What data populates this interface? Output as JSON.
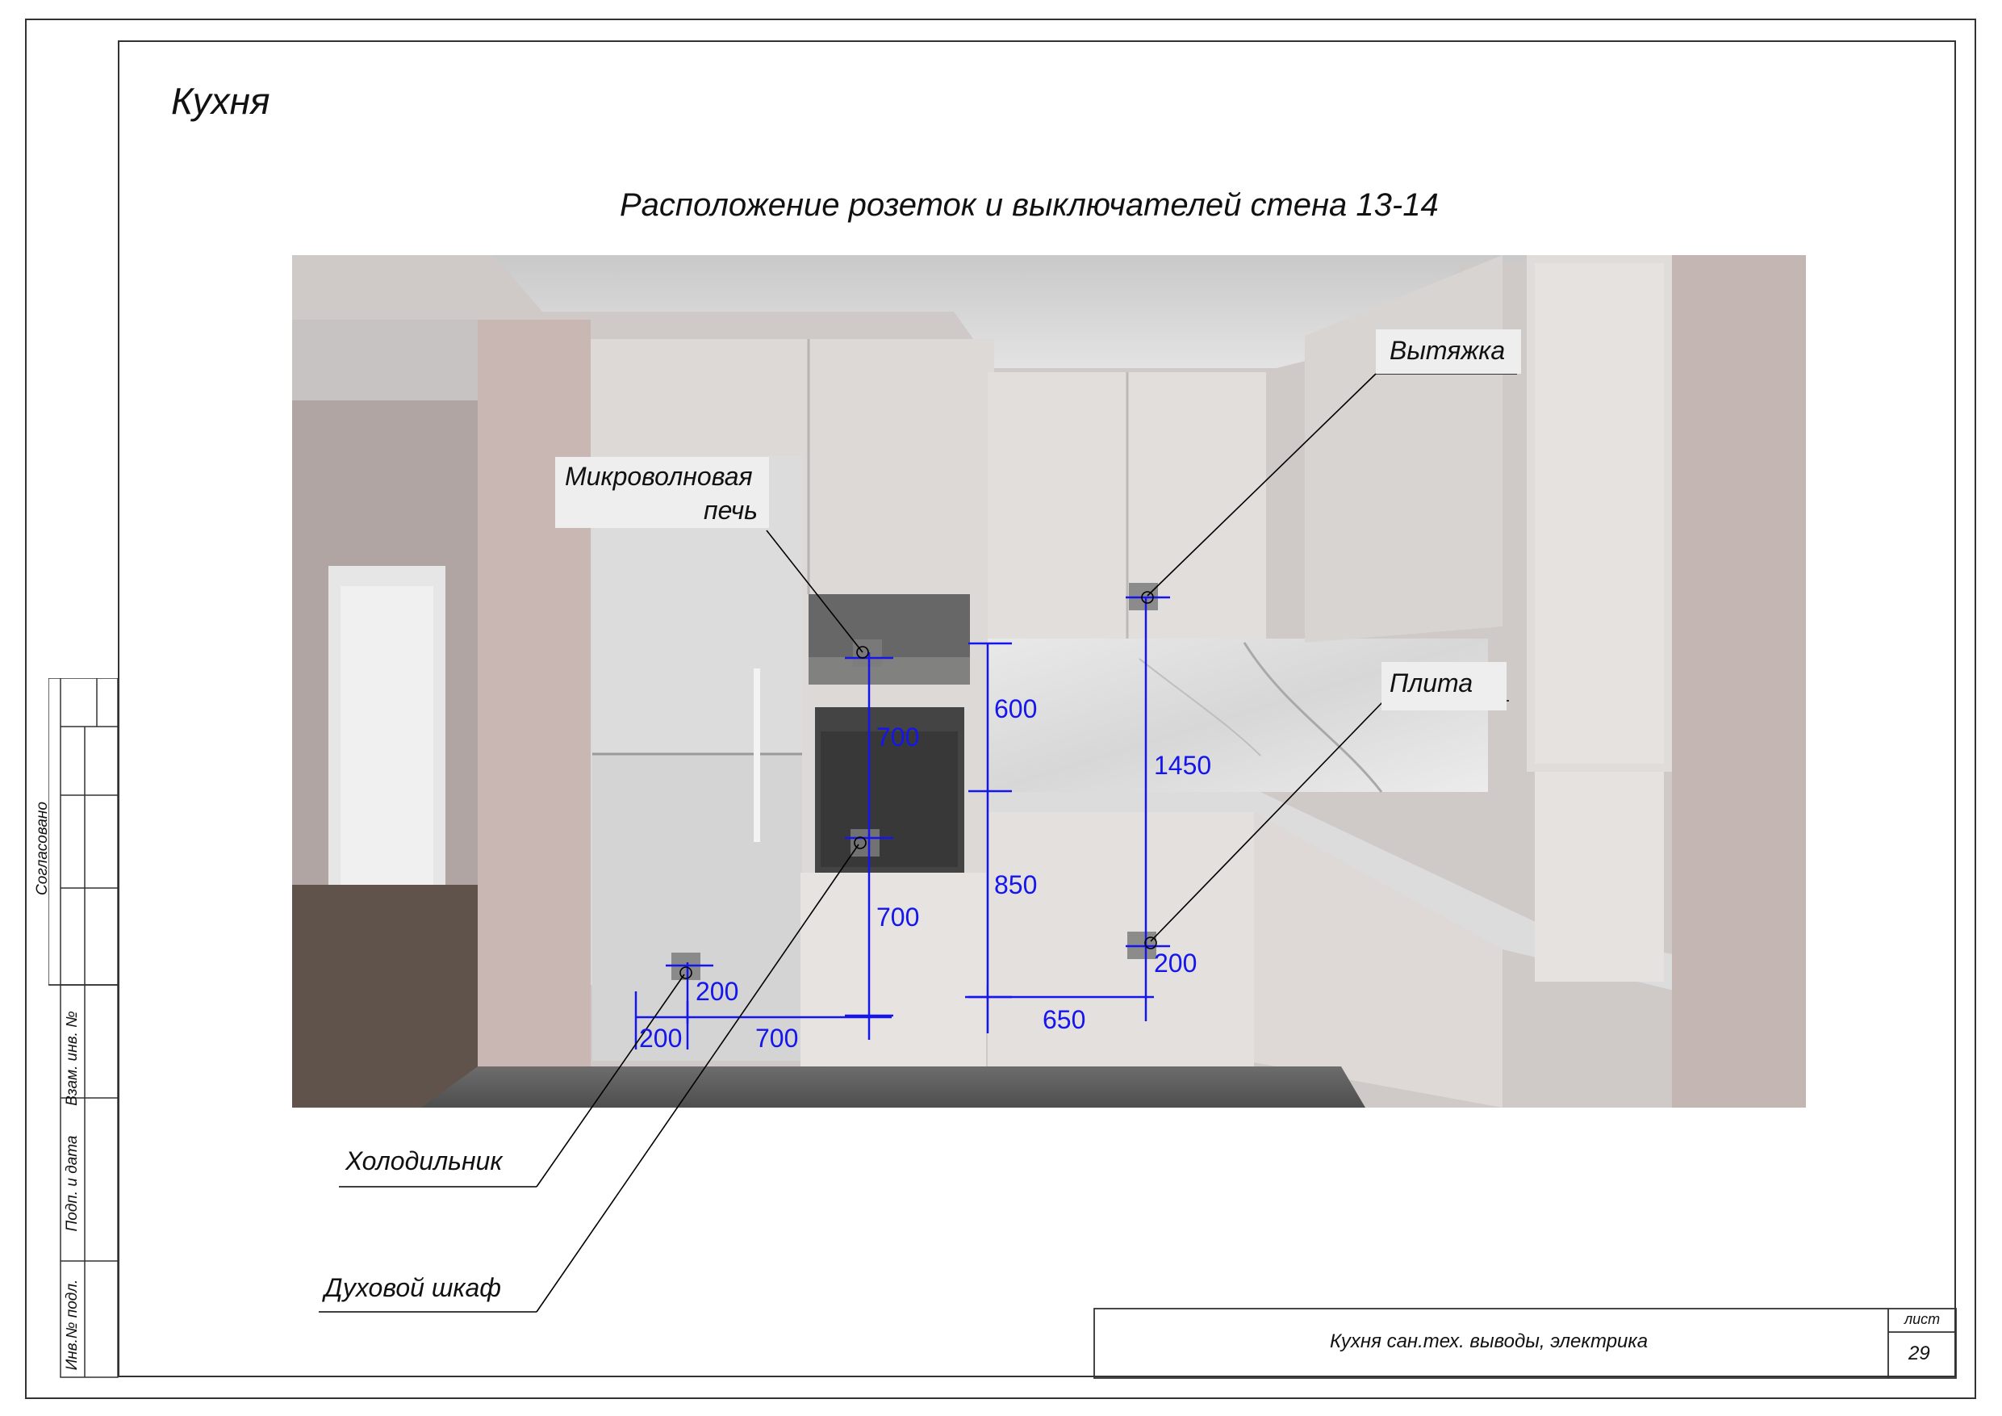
{
  "room_title": "Кухня",
  "sheet_title": "Расположение розеток и выключателей стена 13-14",
  "side_stamp": {
    "approved": "Согласовано",
    "ref_inv": "Взам. инв. №",
    "sign_date": "Подп. и дата",
    "inv_orig": "Инв.№ подл."
  },
  "title_block": {
    "description": "Кухня сан.тех. выводы, электрика",
    "sheet_label": "лист",
    "sheet_number": "29"
  },
  "callouts": {
    "hood": "Вытяжка",
    "microwave_line1": "Микроволновая",
    "microwave_line2": "печь",
    "stove": "Плита",
    "fridge": "Холодильник",
    "oven": "Духовой шкаф"
  },
  "dimensions": {
    "mw_to_oven": "700",
    "oven_height": "700",
    "upper_gap": "600",
    "counter_height": "850",
    "hood_height": "1450",
    "stove_height": "200",
    "stove_offset": "650",
    "fridge_height": "200",
    "fridge_offset": "200",
    "fridge_to_oven": "700"
  },
  "colors": {
    "dimension": "#1515ee",
    "line": "#000000",
    "frame": "#333333"
  }
}
